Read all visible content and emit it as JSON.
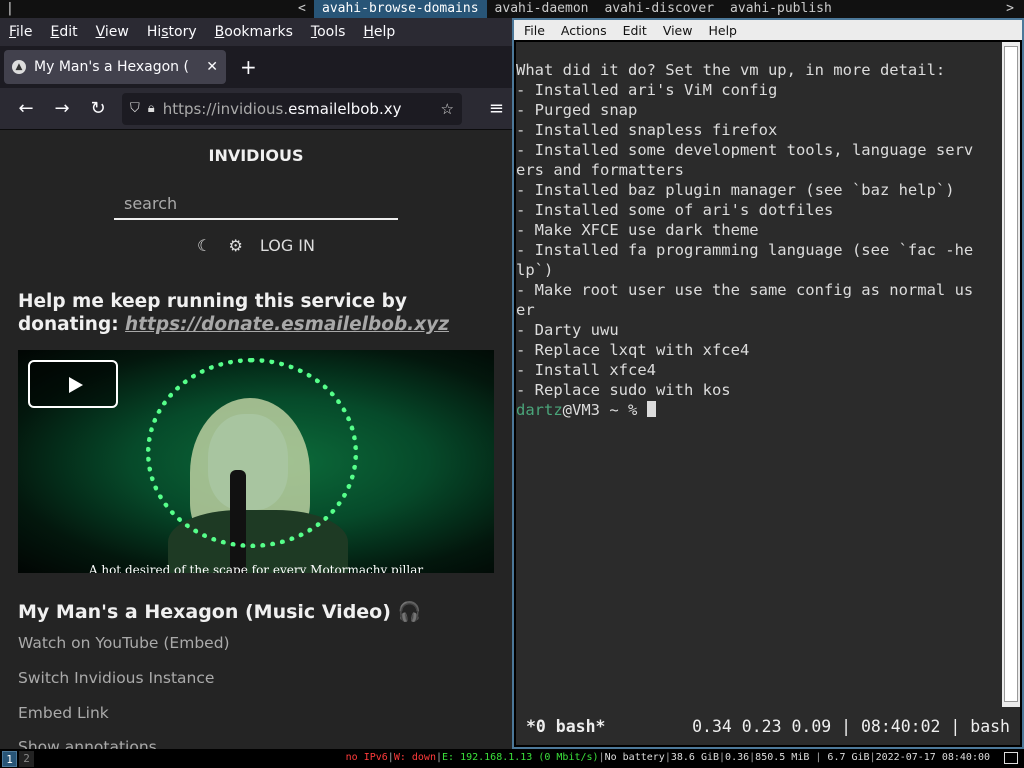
{
  "topbar": {
    "cursor": "|",
    "arrow_left": "<",
    "arrow_right": ">",
    "tabs": [
      {
        "label": "avahi-browse-domains",
        "active": true
      },
      {
        "label": "avahi-daemon",
        "active": false
      },
      {
        "label": "avahi-discover",
        "active": false
      },
      {
        "label": "avahi-publish",
        "active": false
      }
    ]
  },
  "firefox": {
    "menu": [
      {
        "pre": "",
        "u": "F",
        "post": "ile"
      },
      {
        "pre": "",
        "u": "E",
        "post": "dit"
      },
      {
        "pre": "",
        "u": "V",
        "post": "iew"
      },
      {
        "pre": "Hi",
        "u": "s",
        "post": "tory"
      },
      {
        "pre": "",
        "u": "B",
        "post": "ookmarks"
      },
      {
        "pre": "",
        "u": "T",
        "post": "ools"
      },
      {
        "pre": "",
        "u": "H",
        "post": "elp"
      }
    ],
    "tab_title": "My Man's a Hexagon (",
    "tab_close": "✕",
    "new_tab": "+",
    "url_prefix": "https://invidious.",
    "url_domain": "esmailelbob.xy",
    "icons": {
      "back": "arrow-left-icon",
      "forward": "arrow-right-icon",
      "reload": "reload-icon",
      "shield": "shield-icon",
      "lock": "lock-icon",
      "star": "star-icon",
      "menu": "hamburger-icon"
    }
  },
  "invidious": {
    "logo": "INVIDIOUS",
    "search_placeholder": "search",
    "theme_icon": "☾",
    "settings_icon": "⚙",
    "login": "LOG IN",
    "donate_text": "Help me keep running this service by donating: ",
    "donate_link": "https://donate.esmailelbob.xyz",
    "caption": "A hot desired of the scape for every Motormachy pillar",
    "video_title": "My Man's a Hexagon (Music Video)",
    "headphones": "🎧",
    "watch_on_youtube": "Watch on YouTube (",
    "embed": "Embed",
    "watch_close": ")",
    "switch_instance": "Switch Invidious Instance",
    "embed_link": "Embed Link",
    "show_annotations": "Show annotations"
  },
  "terminal": {
    "menu": [
      "File",
      "Actions",
      "Edit",
      "View",
      "Help"
    ],
    "lines": [
      "What did it do? Set the vm up, in more detail:",
      "",
      "- Installed ari's ViM config",
      "- Purged snap",
      "- Installed snapless firefox",
      "- Installed some development tools, language serv",
      "ers and formatters",
      "- Installed baz plugin manager (see `baz help`)",
      "- Installed some of ari's dotfiles",
      "- Make XFCE use dark theme",
      "- Installed fa programming language (see `fac -he",
      "lp`)",
      "- Make root user use the same config as normal us",
      "er",
      "- Darty uwu",
      "- Replace lxqt with xfce4",
      "- Install xfce4",
      "- Replace sudo with kos",
      ""
    ],
    "prompt_user": "dartz",
    "prompt_rest": "@VM3 ~ % ",
    "tmux_window": "*0 bash*",
    "tmux_right": "0.34 0.23 0.09 | 08:40:02 | bash"
  },
  "bottombar": {
    "workspaces": [
      {
        "label": "1",
        "active": true
      },
      {
        "label": "2",
        "active": false
      }
    ],
    "ipv6": "no IPv6",
    "wifi": "W: down",
    "ethernet": "E: 192.168.1.13 (0 Mbit/s)",
    "battery": "No battery",
    "disk": "38.6 GiB",
    "load": "0.36",
    "mem": "850.5 MiB",
    "mem_total": "6.7 GiB",
    "datetime": "2022-07-17 08:40:00",
    "sep": "|",
    "sep_mem": " | "
  },
  "colors": {
    "accent": "#285577",
    "terminal_bg": "#2b2b2b",
    "prompt": "#4aa57a",
    "status_red": "#ff3b3b",
    "status_green": "#3be03b"
  }
}
